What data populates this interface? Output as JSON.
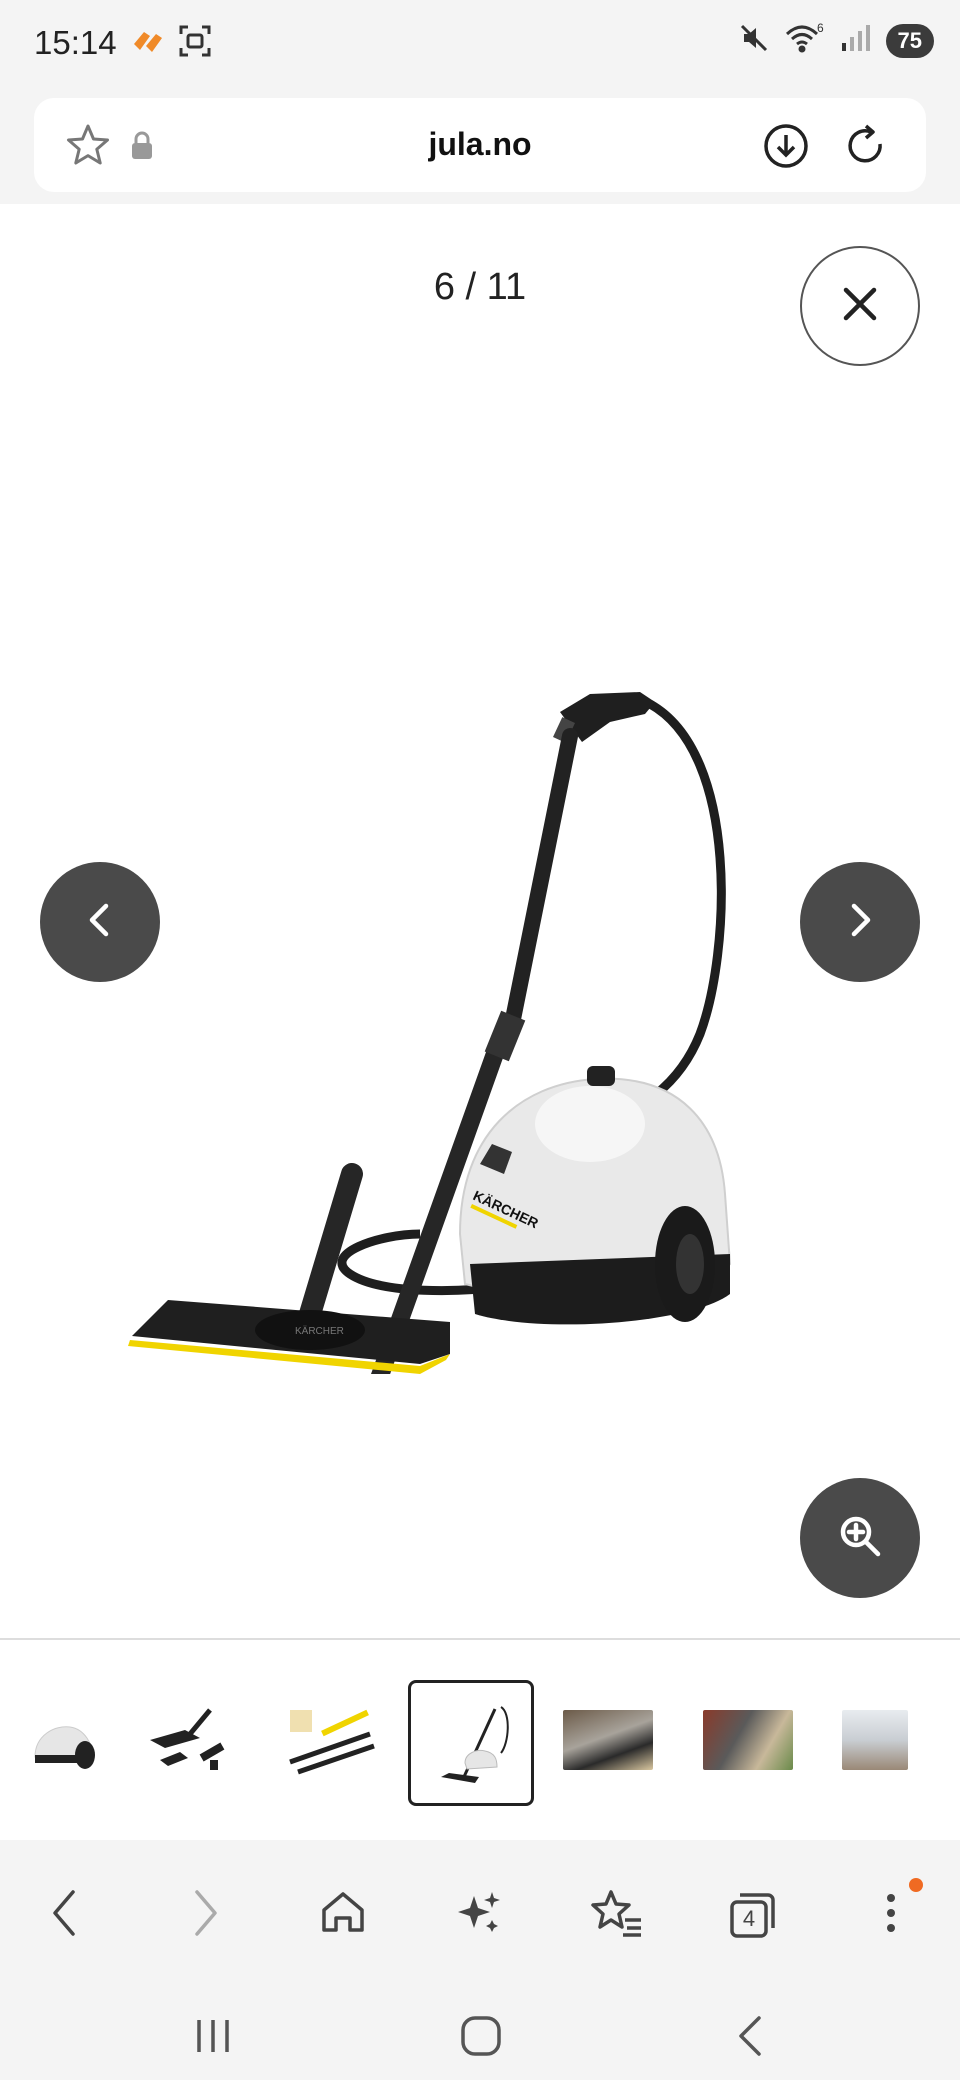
{
  "status": {
    "time": "15:14",
    "battery": "75",
    "wifi_sub": "6"
  },
  "address": {
    "url": "jula.no"
  },
  "gallery": {
    "counter": "6 / 11",
    "brand_label": "KÄRCHER",
    "nozzle_label": "KÄRCHER"
  },
  "thumbnails": [
    {
      "name": "thumb-steam-unit",
      "active": false
    },
    {
      "name": "thumb-accessories",
      "active": false
    },
    {
      "name": "thumb-pads-tubes",
      "active": false
    },
    {
      "name": "thumb-steam-mop",
      "active": true
    },
    {
      "name": "thumb-table-scene",
      "active": false
    },
    {
      "name": "thumb-kitchen-scene",
      "active": false
    },
    {
      "name": "thumb-room-scene",
      "active": false
    }
  ],
  "toolbar": {
    "tabs_count": "4"
  },
  "colors": {
    "accent_orange": "#f06a22",
    "button_dark": "#4a4a4a",
    "kaercher_yellow": "#f0d400"
  }
}
